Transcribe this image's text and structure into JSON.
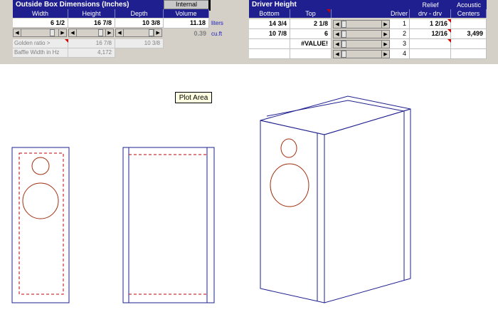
{
  "outside_box": {
    "header": "Outside Box Dimensions (Inches)",
    "columns": [
      "Width",
      "Height",
      "Depth"
    ],
    "values": [
      "6 1/2",
      "16 7/8",
      "10 3/8"
    ],
    "golden_label": "Golden ratio >",
    "golden_values": [
      "16 7/8",
      "10 3/8"
    ],
    "baffle_label": "Baffle Width in Hz",
    "baffle_value": "4,172"
  },
  "internal": {
    "header": "Internal",
    "column": "Volume",
    "liters_value": "11.18",
    "liters_unit": "liters",
    "cuft_value": "0.39",
    "cuft_unit": "cu.ft"
  },
  "driver": {
    "header": "Driver Height",
    "columns": [
      "Bottom",
      "Top",
      "Driver"
    ],
    "relief_header": "Relief",
    "relief_sub": "drv - drv",
    "acoustic_header": "Acoustic",
    "acoustic_sub": "Centers",
    "rows": [
      {
        "bottom": "14 3/4",
        "top": "2 1/8",
        "num": "1",
        "relief": "1  2/16",
        "acoustic": ""
      },
      {
        "bottom": "10 7/8",
        "top": "6",
        "num": "2",
        "relief": "12/16",
        "acoustic": "3,499"
      },
      {
        "bottom": "",
        "top": "#VALUE!",
        "num": "3",
        "relief": "",
        "acoustic": ""
      },
      {
        "bottom": "",
        "top": "",
        "num": "4",
        "relief": "",
        "acoustic": ""
      }
    ]
  },
  "tooltip": "Plot Area",
  "colors": {
    "header_bg": "#1f1f8f",
    "outline": "#1f1f8f",
    "driver_outline": "#a03010",
    "dash": "#c00000"
  }
}
